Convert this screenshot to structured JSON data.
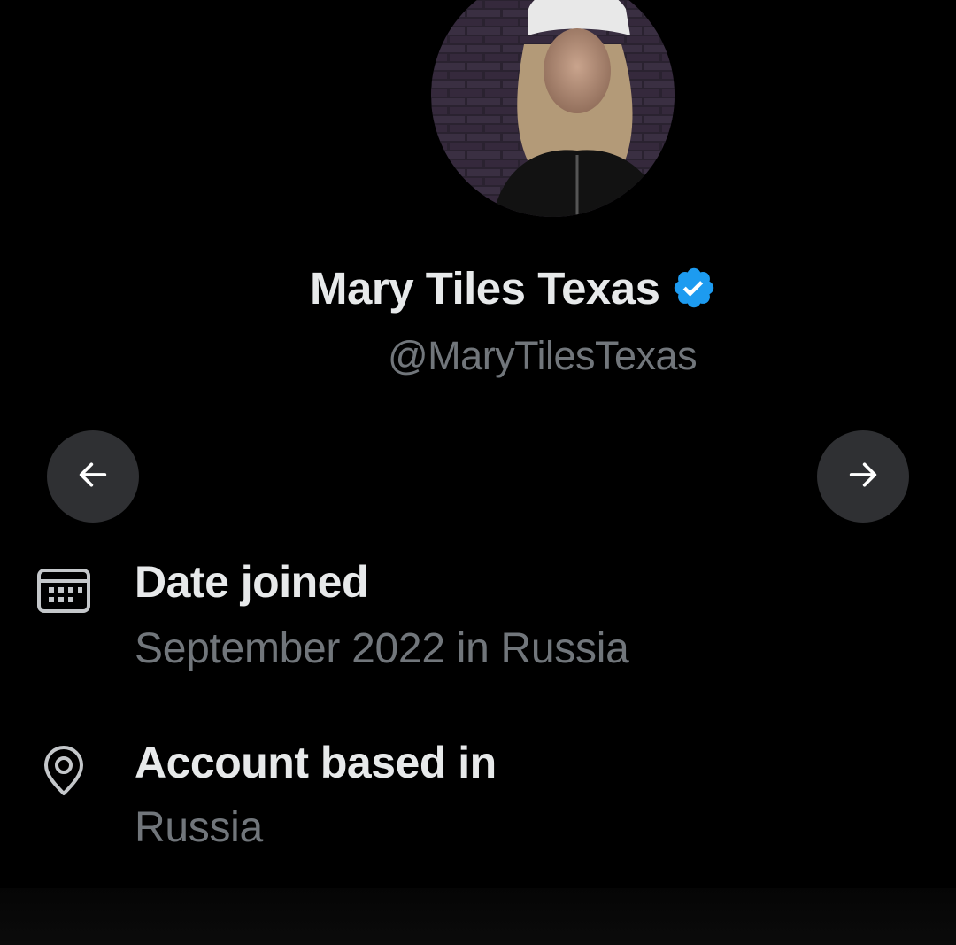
{
  "profile": {
    "display_name": "Mary Tiles Texas",
    "handle": "@MaryTilesTexas",
    "verified": true,
    "verified_color": "#1d9bf0"
  },
  "navigation": {
    "prev_icon": "arrow-left-icon",
    "next_icon": "arrow-right-icon"
  },
  "about": {
    "date_joined": {
      "label": "Date joined",
      "value": "September 2022 in Russia",
      "icon": "calendar-icon"
    },
    "account_based_in": {
      "label": "Account based in",
      "value": "Russia",
      "icon": "location-pin-icon"
    }
  },
  "colors": {
    "background": "#000000",
    "primary_text": "#e7e9ea",
    "secondary_text": "#71767b",
    "nav_button": "#2f3033"
  }
}
